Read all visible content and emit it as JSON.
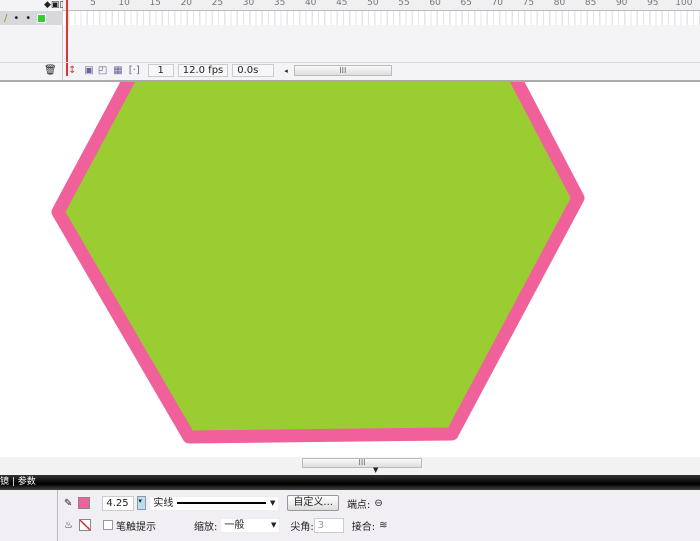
{
  "timeline": {
    "ruler_ticks": [
      "5",
      "10",
      "15",
      "20",
      "25",
      "30",
      "35",
      "40",
      "45",
      "50",
      "55",
      "60",
      "65",
      "70",
      "75",
      "80",
      "85",
      "90",
      "95",
      "100"
    ],
    "current_frame": "1",
    "fps": "12.0 fps",
    "elapsed": "0.0s",
    "scroll_grip": "III"
  },
  "stage": {
    "fill_color": "#9acd32",
    "stroke_color": "#f0609a",
    "scroll_grip": "III"
  },
  "panel": {
    "tabs": "镜 | 参数",
    "stroke_width": "4.25",
    "stroke_style": "实线",
    "custom_button": "自定义...",
    "cap_label": "端点:",
    "stroke_hint_label": "笔触提示",
    "scale_label": "缩放:",
    "scale_value": "一般",
    "miter_label": "尖角:",
    "miter_value": "3",
    "join_label": "接合:",
    "stroke_color": "#f0609a"
  }
}
